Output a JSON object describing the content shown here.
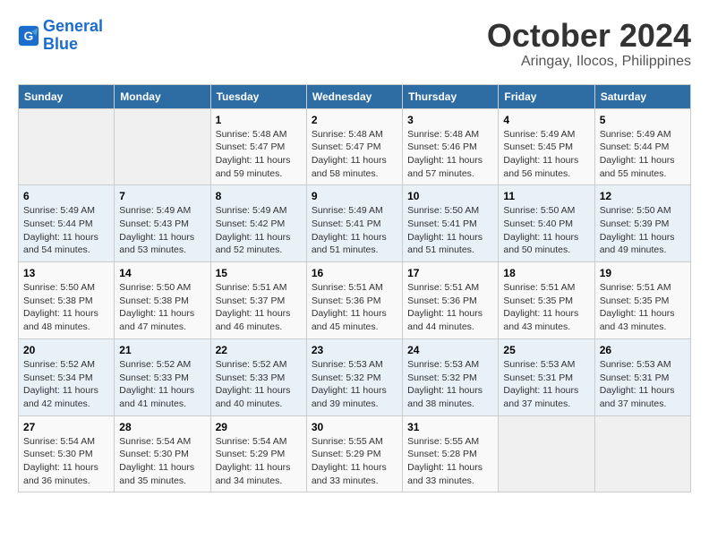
{
  "header": {
    "logo_line1": "General",
    "logo_line2": "Blue",
    "month_title": "October 2024",
    "subtitle": "Aringay, Ilocos, Philippines"
  },
  "columns": [
    "Sunday",
    "Monday",
    "Tuesday",
    "Wednesday",
    "Thursday",
    "Friday",
    "Saturday"
  ],
  "weeks": [
    [
      {
        "day": "",
        "sunrise": "",
        "sunset": "",
        "daylight": ""
      },
      {
        "day": "",
        "sunrise": "",
        "sunset": "",
        "daylight": ""
      },
      {
        "day": "1",
        "sunrise": "Sunrise: 5:48 AM",
        "sunset": "Sunset: 5:47 PM",
        "daylight": "Daylight: 11 hours and 59 minutes."
      },
      {
        "day": "2",
        "sunrise": "Sunrise: 5:48 AM",
        "sunset": "Sunset: 5:47 PM",
        "daylight": "Daylight: 11 hours and 58 minutes."
      },
      {
        "day": "3",
        "sunrise": "Sunrise: 5:48 AM",
        "sunset": "Sunset: 5:46 PM",
        "daylight": "Daylight: 11 hours and 57 minutes."
      },
      {
        "day": "4",
        "sunrise": "Sunrise: 5:49 AM",
        "sunset": "Sunset: 5:45 PM",
        "daylight": "Daylight: 11 hours and 56 minutes."
      },
      {
        "day": "5",
        "sunrise": "Sunrise: 5:49 AM",
        "sunset": "Sunset: 5:44 PM",
        "daylight": "Daylight: 11 hours and 55 minutes."
      }
    ],
    [
      {
        "day": "6",
        "sunrise": "Sunrise: 5:49 AM",
        "sunset": "Sunset: 5:44 PM",
        "daylight": "Daylight: 11 hours and 54 minutes."
      },
      {
        "day": "7",
        "sunrise": "Sunrise: 5:49 AM",
        "sunset": "Sunset: 5:43 PM",
        "daylight": "Daylight: 11 hours and 53 minutes."
      },
      {
        "day": "8",
        "sunrise": "Sunrise: 5:49 AM",
        "sunset": "Sunset: 5:42 PM",
        "daylight": "Daylight: 11 hours and 52 minutes."
      },
      {
        "day": "9",
        "sunrise": "Sunrise: 5:49 AM",
        "sunset": "Sunset: 5:41 PM",
        "daylight": "Daylight: 11 hours and 51 minutes."
      },
      {
        "day": "10",
        "sunrise": "Sunrise: 5:50 AM",
        "sunset": "Sunset: 5:41 PM",
        "daylight": "Daylight: 11 hours and 51 minutes."
      },
      {
        "day": "11",
        "sunrise": "Sunrise: 5:50 AM",
        "sunset": "Sunset: 5:40 PM",
        "daylight": "Daylight: 11 hours and 50 minutes."
      },
      {
        "day": "12",
        "sunrise": "Sunrise: 5:50 AM",
        "sunset": "Sunset: 5:39 PM",
        "daylight": "Daylight: 11 hours and 49 minutes."
      }
    ],
    [
      {
        "day": "13",
        "sunrise": "Sunrise: 5:50 AM",
        "sunset": "Sunset: 5:38 PM",
        "daylight": "Daylight: 11 hours and 48 minutes."
      },
      {
        "day": "14",
        "sunrise": "Sunrise: 5:50 AM",
        "sunset": "Sunset: 5:38 PM",
        "daylight": "Daylight: 11 hours and 47 minutes."
      },
      {
        "day": "15",
        "sunrise": "Sunrise: 5:51 AM",
        "sunset": "Sunset: 5:37 PM",
        "daylight": "Daylight: 11 hours and 46 minutes."
      },
      {
        "day": "16",
        "sunrise": "Sunrise: 5:51 AM",
        "sunset": "Sunset: 5:36 PM",
        "daylight": "Daylight: 11 hours and 45 minutes."
      },
      {
        "day": "17",
        "sunrise": "Sunrise: 5:51 AM",
        "sunset": "Sunset: 5:36 PM",
        "daylight": "Daylight: 11 hours and 44 minutes."
      },
      {
        "day": "18",
        "sunrise": "Sunrise: 5:51 AM",
        "sunset": "Sunset: 5:35 PM",
        "daylight": "Daylight: 11 hours and 43 minutes."
      },
      {
        "day": "19",
        "sunrise": "Sunrise: 5:51 AM",
        "sunset": "Sunset: 5:35 PM",
        "daylight": "Daylight: 11 hours and 43 minutes."
      }
    ],
    [
      {
        "day": "20",
        "sunrise": "Sunrise: 5:52 AM",
        "sunset": "Sunset: 5:34 PM",
        "daylight": "Daylight: 11 hours and 42 minutes."
      },
      {
        "day": "21",
        "sunrise": "Sunrise: 5:52 AM",
        "sunset": "Sunset: 5:33 PM",
        "daylight": "Daylight: 11 hours and 41 minutes."
      },
      {
        "day": "22",
        "sunrise": "Sunrise: 5:52 AM",
        "sunset": "Sunset: 5:33 PM",
        "daylight": "Daylight: 11 hours and 40 minutes."
      },
      {
        "day": "23",
        "sunrise": "Sunrise: 5:53 AM",
        "sunset": "Sunset: 5:32 PM",
        "daylight": "Daylight: 11 hours and 39 minutes."
      },
      {
        "day": "24",
        "sunrise": "Sunrise: 5:53 AM",
        "sunset": "Sunset: 5:32 PM",
        "daylight": "Daylight: 11 hours and 38 minutes."
      },
      {
        "day": "25",
        "sunrise": "Sunrise: 5:53 AM",
        "sunset": "Sunset: 5:31 PM",
        "daylight": "Daylight: 11 hours and 37 minutes."
      },
      {
        "day": "26",
        "sunrise": "Sunrise: 5:53 AM",
        "sunset": "Sunset: 5:31 PM",
        "daylight": "Daylight: 11 hours and 37 minutes."
      }
    ],
    [
      {
        "day": "27",
        "sunrise": "Sunrise: 5:54 AM",
        "sunset": "Sunset: 5:30 PM",
        "daylight": "Daylight: 11 hours and 36 minutes."
      },
      {
        "day": "28",
        "sunrise": "Sunrise: 5:54 AM",
        "sunset": "Sunset: 5:30 PM",
        "daylight": "Daylight: 11 hours and 35 minutes."
      },
      {
        "day": "29",
        "sunrise": "Sunrise: 5:54 AM",
        "sunset": "Sunset: 5:29 PM",
        "daylight": "Daylight: 11 hours and 34 minutes."
      },
      {
        "day": "30",
        "sunrise": "Sunrise: 5:55 AM",
        "sunset": "Sunset: 5:29 PM",
        "daylight": "Daylight: 11 hours and 33 minutes."
      },
      {
        "day": "31",
        "sunrise": "Sunrise: 5:55 AM",
        "sunset": "Sunset: 5:28 PM",
        "daylight": "Daylight: 11 hours and 33 minutes."
      },
      {
        "day": "",
        "sunrise": "",
        "sunset": "",
        "daylight": ""
      },
      {
        "day": "",
        "sunrise": "",
        "sunset": "",
        "daylight": ""
      }
    ]
  ]
}
